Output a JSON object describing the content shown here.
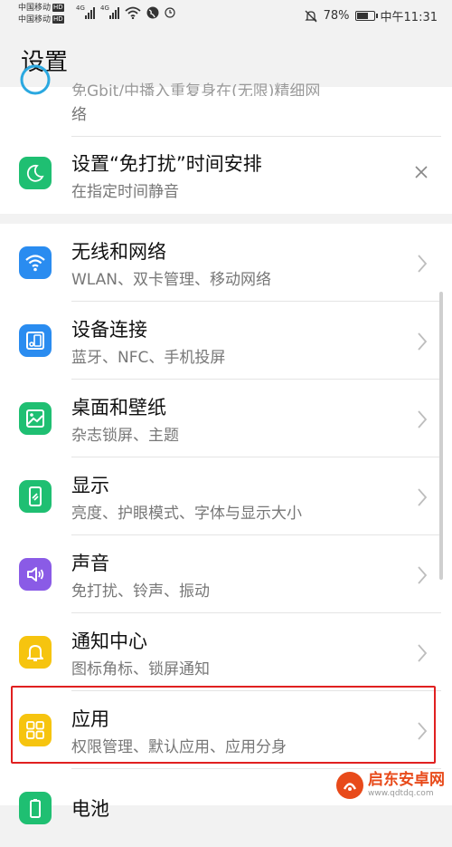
{
  "status_bar": {
    "carrier_1": "中国移动",
    "carrier_2": "中国移动",
    "hd": "HD",
    "network_type": "4G",
    "battery": "78%",
    "battery_level": 0.78,
    "time": "中午11:31"
  },
  "header": {
    "title": "设置"
  },
  "partial_item": {
    "subtitle": "免Gbit/中播入重复身在(无限)精细网",
    "subtitle_line2": "络"
  },
  "dnd_suggestion": {
    "title": "设置“免打扰”时间安排",
    "subtitle": "在指定时间静音",
    "close_icon": "close-icon"
  },
  "items": [
    {
      "key": "wireless",
      "title": "无线和网络",
      "subtitle": "WLAN、双卡管理、移动网络",
      "icon": "wifi-icon",
      "color": "#2a8cf0"
    },
    {
      "key": "devices",
      "title": "设备连接",
      "subtitle": "蓝牙、NFC、手机投屏",
      "icon": "device-connection-icon",
      "color": "#2a8cf0"
    },
    {
      "key": "wallpaper",
      "title": "桌面和壁纸",
      "subtitle": "杂志锁屏、主题",
      "icon": "picture-icon",
      "color": "#1fbf72"
    },
    {
      "key": "display",
      "title": "显示",
      "subtitle": "亮度、护眼模式、字体与显示大小",
      "icon": "display-icon",
      "color": "#1fbf72"
    },
    {
      "key": "sound",
      "title": "声音",
      "subtitle": "免打扰、铃声、振动",
      "icon": "speaker-icon",
      "color": "#8a5be6"
    },
    {
      "key": "notifications",
      "title": "通知中心",
      "subtitle": "图标角标、锁屏通知",
      "icon": "bell-icon",
      "color": "#f6c40f"
    },
    {
      "key": "apps",
      "title": "应用",
      "subtitle": "权限管理、默认应用、应用分身",
      "icon": "apps-grid-icon",
      "color": "#f6c40f"
    },
    {
      "key": "battery",
      "title": "电池",
      "subtitle": "",
      "icon": "battery-icon",
      "color": "#1fbf72"
    }
  ],
  "watermark": {
    "name": "启东安卓网",
    "url": "www.qdtdq.com"
  }
}
